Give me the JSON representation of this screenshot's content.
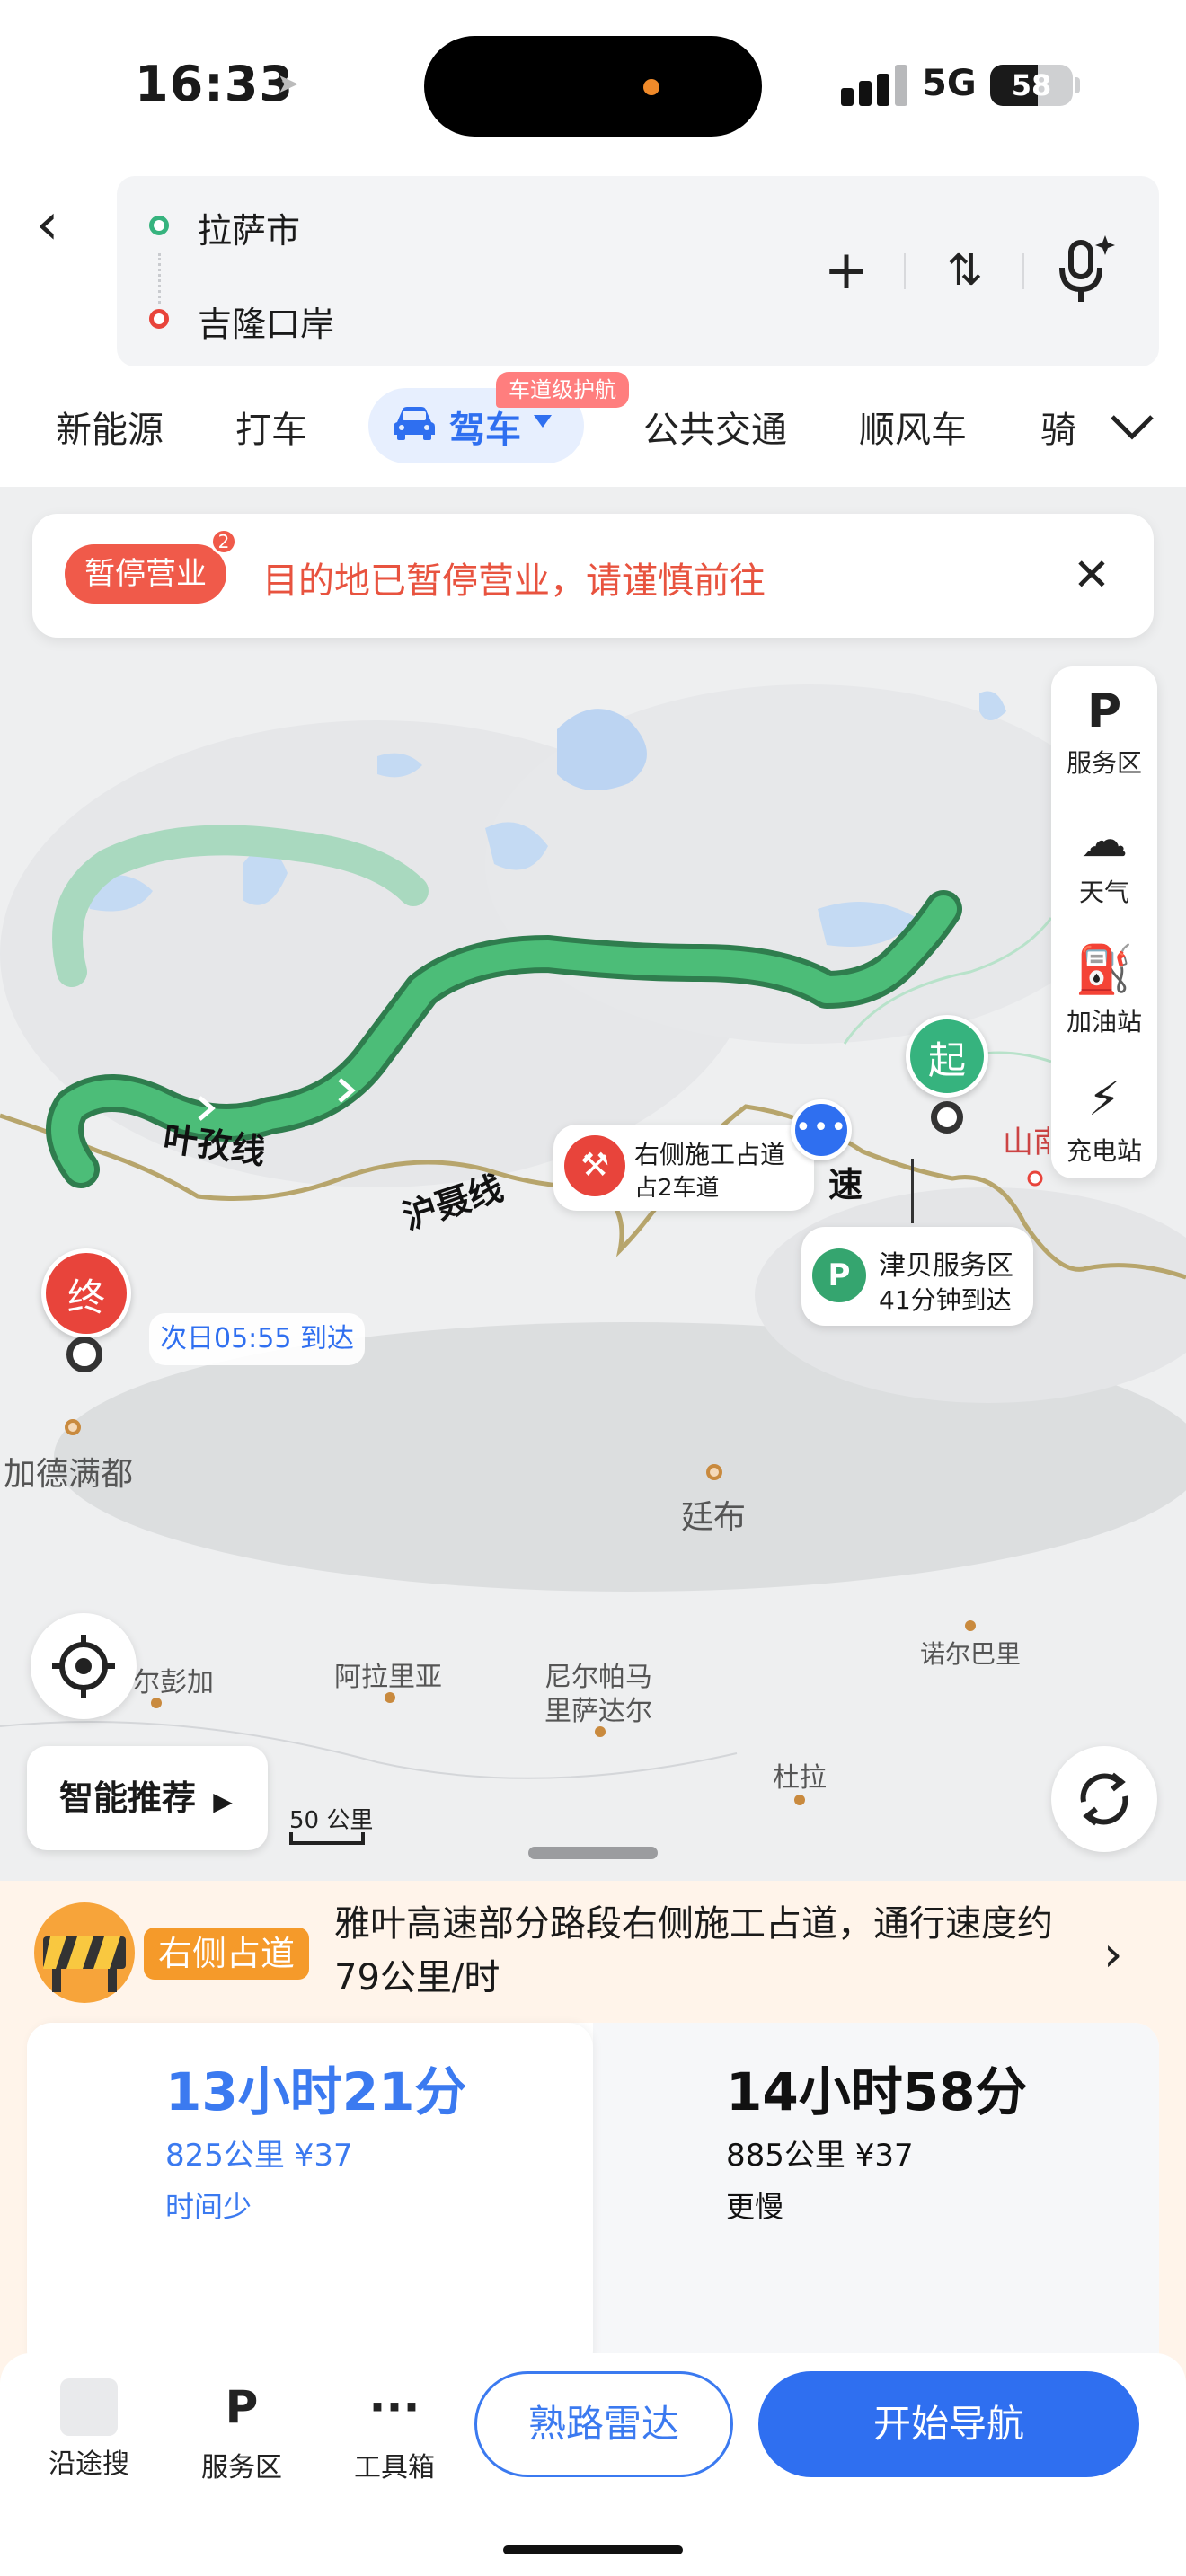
{
  "status_bar": {
    "time": "16:33",
    "network": "5G",
    "battery": "58",
    "battery_level_percent": 58,
    "location_icon": "location-arrow-icon",
    "signal_icon": "cellular-signal-icon"
  },
  "route": {
    "origin": "拉萨市",
    "destination": "吉隆口岸",
    "back_icon": "chevron-left-icon",
    "add_icon": "plus-icon",
    "swap_icon": "swap-vertical-icon",
    "voice_icon": "microphone-sparkle-icon",
    "origin_color": "#36b37e",
    "destination_color": "#e8443b"
  },
  "tabs": {
    "items": [
      "新能源",
      "打车",
      "驾车",
      "公共交通",
      "顺风车",
      "骑"
    ],
    "active": "驾车",
    "active_badge": "车道级护航",
    "expand_icon": "chevron-down-icon",
    "active_icon": "car-icon"
  },
  "notice": {
    "tag": "暂停营业",
    "count": "2",
    "text": "目的地已暂停营业，请谨慎前往",
    "close_icon": "close-icon"
  },
  "side_panel": [
    {
      "label": "服务区",
      "icon": "service-area-icon",
      "glyph": "P"
    },
    {
      "label": "天气",
      "icon": "cloud-icon",
      "glyph": "☁"
    },
    {
      "label": "加油站",
      "icon": "fuel-pump-icon",
      "glyph": "⛽"
    },
    {
      "label": "充电站",
      "icon": "charging-station-icon",
      "glyph": "⚡"
    }
  ],
  "map": {
    "start_pin": "起",
    "end_pin": "终",
    "roads": {
      "yezi": "叶孜线",
      "hunie": "沪聂线",
      "su": "速",
      "shannan": "山南"
    },
    "construction": {
      "line1": "右侧施工占道",
      "line2": "占2车道",
      "icon": "construction-worker-icon"
    },
    "service_area": {
      "name": "津贝服务区",
      "eta": "41分钟到达",
      "icon": "service-area-icon"
    },
    "arrival": "次日05:55 到达",
    "message_icon": "chat-bubble-icon",
    "places": [
      "加德满都",
      "廷布",
      "尔彭加",
      "阿拉里亚",
      "尼尔帕马",
      "里萨达尔",
      "诺尔巴里",
      "杜拉"
    ],
    "scale": "50 公里",
    "recommend": "智能推荐",
    "locate_icon": "crosshair-icon",
    "refresh_icon": "refresh-icon",
    "route_color": "#3fae6a",
    "alt_route_color": "#a9d9bf"
  },
  "traffic_warning": {
    "tag": "右侧占道",
    "text": "雅叶高速部分路段右侧施工占道，通行速度约79公里/时",
    "icon": "construction-barrier-icon",
    "arrow_icon": "chevron-right-icon"
  },
  "routes": [
    {
      "time": "13小时21分",
      "distance": "825公里 ¥37",
      "tag": "时间少",
      "selected": true
    },
    {
      "time": "14小时58分",
      "distance": "885公里 ¥37",
      "tag": "更慢",
      "selected": false
    }
  ],
  "bottom_bar": {
    "tools": [
      {
        "label": "沿途搜",
        "icon": "search-along-route-icon"
      },
      {
        "label": "服务区",
        "icon": "service-area-icon"
      },
      {
        "label": "工具箱",
        "icon": "more-dots-icon"
      }
    ],
    "radar_button": "熟路雷达",
    "navigate_button": "开始导航"
  }
}
